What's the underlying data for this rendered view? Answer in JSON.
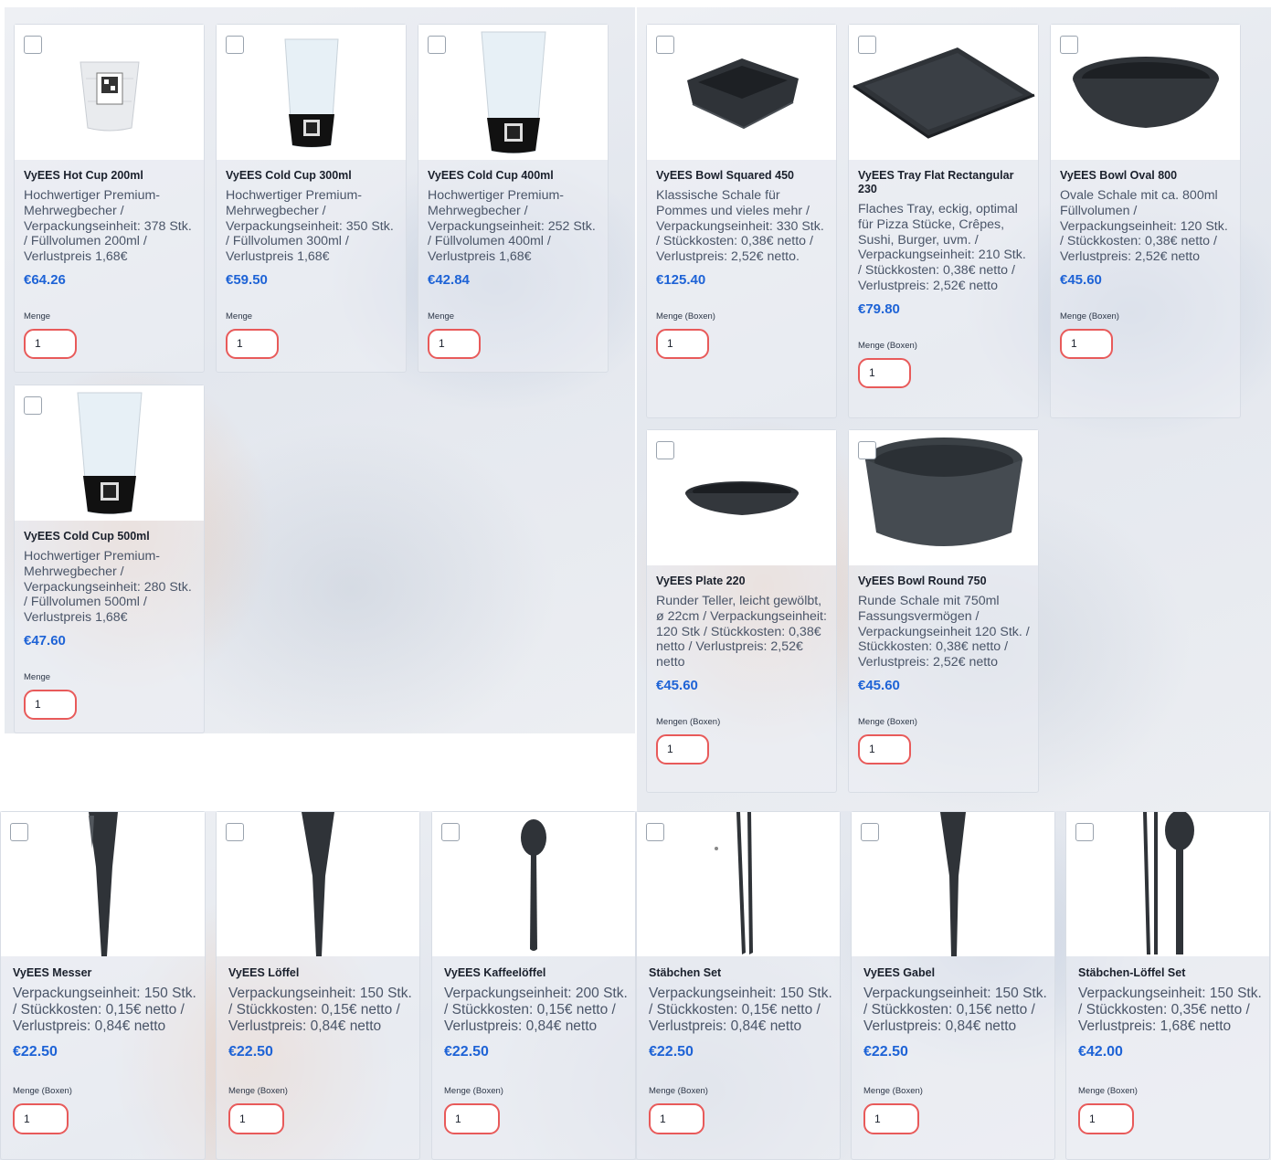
{
  "colors": {
    "price": "#1e63d6",
    "qty_border": "#e85a5a"
  },
  "products": {
    "hot200": {
      "title": "VyEES Hot Cup 200ml",
      "desc": "Hochwertiger Premium-Mehrwegbecher / Verpackungseinheit: 378 Stk. / Füllvolumen 200ml / Verlustpreis 1,68€",
      "price": "€64.26",
      "qty_label": "Menge",
      "qty": "1",
      "icon": "cup-icon"
    },
    "cold300": {
      "title": "VyEES Cold Cup 300ml",
      "desc": "Hochwertiger Premium-Mehrwegbecher / Verpackungseinheit: 350 Stk. / Füllvolumen 300ml / Verlustpreis 1,68€",
      "price": "€59.50",
      "qty_label": "Menge",
      "qty": "1",
      "icon": "cup-icon"
    },
    "cold400": {
      "title": "VyEES Cold Cup 400ml",
      "desc": "Hochwertiger Premium-Mehrwegbecher / Verpackungseinheit: 252 Stk. / Füllvolumen 400ml / Verlustpreis 1,68€",
      "price": "€42.84",
      "qty_label": "Menge",
      "qty": "1",
      "icon": "cup-icon"
    },
    "cold500": {
      "title": "VyEES Cold Cup 500ml",
      "desc": "Hochwertiger Premium-Mehrwegbecher / Verpackungseinheit: 280 Stk. / Füllvolumen 500ml / Verlustpreis 1,68€",
      "price": "€47.60",
      "qty_label": "Menge",
      "qty": "1",
      "icon": "cup-icon"
    },
    "bowlsq": {
      "title": "VyEES Bowl Squared 450",
      "desc": "Klassische Schale für Pommes und vieles mehr / Verpackungseinheit: 330 Stk. / Stückkosten: 0,38€ netto / Verlustpreis: 2,52€ netto.",
      "price": "€125.40",
      "qty_label": "Menge (Boxen)",
      "qty": "1",
      "icon": "bowl-icon"
    },
    "tray": {
      "title": "VyEES Tray Flat Rectangular 230",
      "desc": "Flaches Tray, eckig, optimal für Pizza Stücke, Crêpes, Sushi, Burger, uvm. / Verpackungseinheit: 210 Stk. / Stückkosten: 0,38€ netto / Verlustpreis: 2,52€ netto",
      "price": "€79.80",
      "qty_label": "Menge (Boxen)",
      "qty": "1",
      "icon": "tray-icon"
    },
    "bowloval": {
      "title": "VyEES Bowl Oval 800",
      "desc": "Ovale Schale mit ca. 800ml Füllvolumen / Verpackungseinheit: 120 Stk. / Stückkosten: 0,38€ netto / Verlustpreis: 2,52€ netto",
      "price": "€45.60",
      "qty_label": "Menge (Boxen)",
      "qty": "1",
      "icon": "bowl-icon"
    },
    "plate": {
      "title": "VyEES Plate 220",
      "desc": "Runder Teller, leicht gewölbt, ø 22cm / Verpackungseinheit: 120 Stk / Stückkosten: 0,38€ netto / Verlustpreis: 2,52€ netto",
      "price": "€45.60",
      "qty_label": "Mengen (Boxen)",
      "qty": "1",
      "icon": "plate-icon"
    },
    "bowlround": {
      "title": "VyEES Bowl Round 750",
      "desc": "Runde Schale mit 750ml Fassungsvermögen / Verpackungseinheit 120 Stk. / Stückkosten: 0,38€ netto / Verlustpreis: 2,52€ netto",
      "price": "€45.60",
      "qty_label": "Menge (Boxen)",
      "qty": "1",
      "icon": "bowl-icon"
    },
    "messer": {
      "title": "VyEES Messer",
      "desc": "Verpackungseinheit: 150 Stk. / Stückkosten: 0,15€ netto / Verlustpreis: 0,84€ netto",
      "price": "€22.50",
      "qty_label": "Menge (Boxen)",
      "qty": "1",
      "icon": "knife-icon"
    },
    "loeffel": {
      "title": "VyEES Löffel",
      "desc": "Verpackungseinheit: 150 Stk. / Stückkosten: 0,15€ netto / Verlustpreis: 0,84€ netto",
      "price": "€22.50",
      "qty_label": "Menge (Boxen)",
      "qty": "1",
      "icon": "spoon-icon"
    },
    "kaffee": {
      "title": "VyEES Kaffeelöffel",
      "desc": "Verpackungseinheit: 200 Stk. / Stückkosten: 0,15€ netto / Verlustpreis: 0,84€ netto",
      "price": "€22.50",
      "qty_label": "Menge (Boxen)",
      "qty": "1",
      "icon": "teaspoon-icon"
    },
    "staebchen": {
      "title": "Stäbchen Set",
      "desc": "Verpackungseinheit: 150 Stk. / Stückkosten: 0,15€ netto / Verlustpreis: 0,84€ netto",
      "price": "€22.50",
      "qty_label": "Menge (Boxen)",
      "qty": "1",
      "icon": "chopsticks-icon"
    },
    "gabel": {
      "title": "VyEES Gabel",
      "desc": "Verpackungseinheit: 150 Stk. / Stückkosten: 0,15€ netto / Verlustpreis: 0,84€ netto",
      "price": "€22.50",
      "qty_label": "Menge (Boxen)",
      "qty": "1",
      "icon": "fork-icon"
    },
    "staebloeffel": {
      "title": "Stäbchen-Löffel Set",
      "desc": "Verpackungseinheit: 150 Stk. / Stückkosten: 0,35€ netto / Verlustpreis: 1,68€ netto",
      "price": "€42.00",
      "qty_label": "Menge (Boxen)",
      "qty": "1",
      "icon": "chopsticks-spoon-icon"
    }
  }
}
